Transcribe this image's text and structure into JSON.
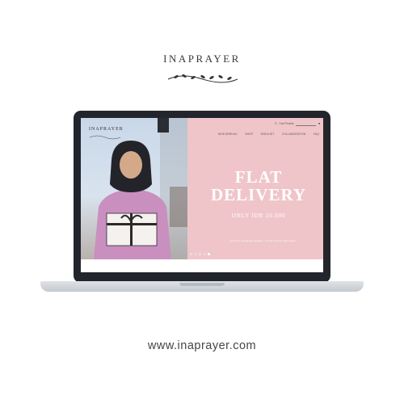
{
  "page": {
    "brand_name": "INAPRAYER",
    "url": "www.inaprayer.com",
    "colors": {
      "banner_pink": "#efc5c9",
      "laptop_frame": "#22252c",
      "text_dark": "#3a3a3a"
    }
  },
  "site": {
    "logo": "INAPRAYER",
    "search_placeholder": "Cari Produk",
    "search_icon": "search-icon",
    "cart_icon": "cart-icon",
    "nav": [
      "NEW ARRIVAL",
      "SHOP",
      "WISHLIST",
      "COLLABORATION",
      "FAQ"
    ]
  },
  "banner": {
    "headline_line1": "FLAT",
    "headline_line2": "DELIVERY",
    "subheadline": "ONLY IDR 10.000",
    "fine_print": "syarat & ketentuan berlaku, *untuk seluruh indonesia",
    "slides": {
      "count": 5,
      "active": 5
    }
  }
}
